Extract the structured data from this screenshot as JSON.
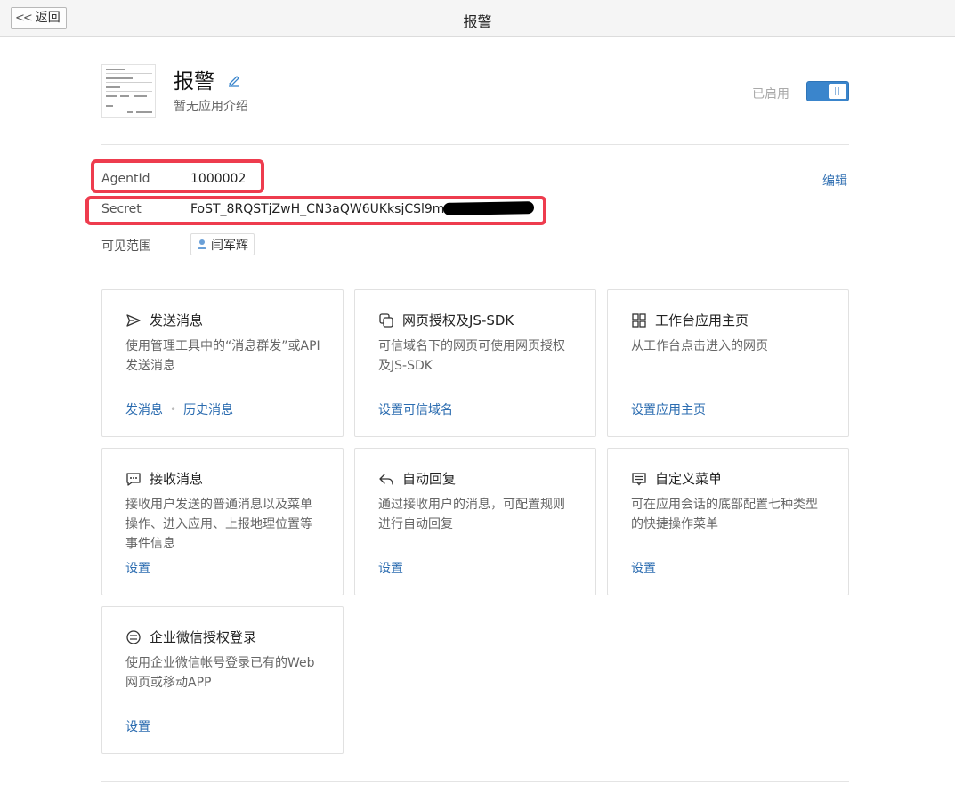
{
  "topbar": {
    "back_label": "返回",
    "title": "报警"
  },
  "app": {
    "name": "报警",
    "description": "暂无应用介绍",
    "status_label": "已启用",
    "enabled": true
  },
  "info": {
    "agentid_label": "AgentId",
    "agentid_value": "1000002",
    "secret_label": "Secret",
    "secret_value": "FoST_8RQSTjZwH_CN3aQW6UKksjCSl9m",
    "scope_label": "可见范围",
    "scope_member": "闫军辉",
    "edit_label": "编辑"
  },
  "cards": [
    {
      "icon": "send-icon",
      "title": "发送消息",
      "desc": "使用管理工具中的“消息群发”或API发送消息",
      "links": [
        "发消息",
        "历史消息"
      ]
    },
    {
      "icon": "web-auth-icon",
      "title": "网页授权及JS-SDK",
      "desc": "可信域名下的网页可使用网页授权及JS-SDK",
      "links": [
        "设置可信域名"
      ]
    },
    {
      "icon": "grid-icon",
      "title": "工作台应用主页",
      "desc": "从工作台点击进入的网页",
      "links": [
        "设置应用主页"
      ]
    },
    {
      "icon": "chat-icon",
      "title": "接收消息",
      "desc": "接收用户发送的普通消息以及菜单操作、进入应用、上报地理位置等事件信息",
      "links": [
        "设置"
      ]
    },
    {
      "icon": "reply-icon",
      "title": "自动回复",
      "desc": "通过接收用户的消息，可配置规则进行自动回复",
      "links": [
        "设置"
      ]
    },
    {
      "icon": "menu-icon",
      "title": "自定义菜单",
      "desc": "可在应用会话的底部配置七种类型的快捷操作菜单",
      "links": [
        "设置"
      ]
    },
    {
      "icon": "login-icon",
      "title": "企业微信授权登录",
      "desc": "使用企业微信帐号登录已有的Web网页或移动APP",
      "links": [
        "设置"
      ]
    }
  ],
  "colors": {
    "accent": "#2b6cb0",
    "toggle": "#3a85cc",
    "highlight": "#ee3c4e"
  }
}
